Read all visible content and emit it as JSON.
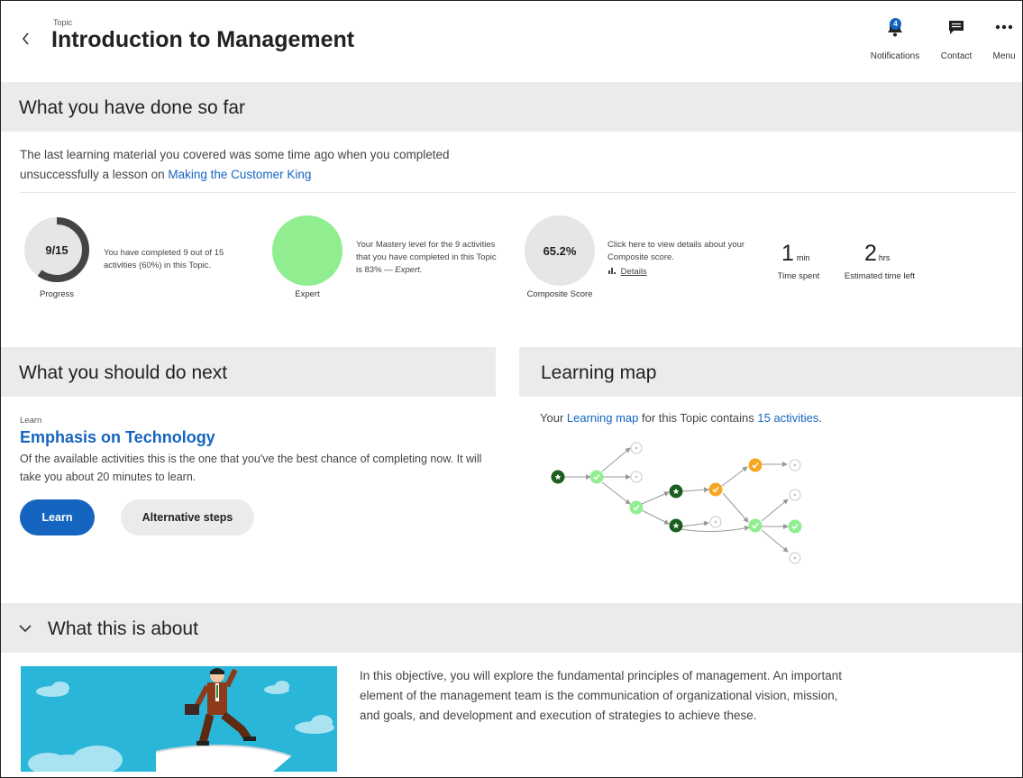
{
  "header": {
    "topic_label": "Topic",
    "title": "Introduction to Management",
    "notifications_label": "Notifications",
    "notifications_count": "4",
    "contact_label": "Contact",
    "menu_label": "Menu"
  },
  "done_section": {
    "heading": "What you have done so far",
    "intro_text": "The last learning material you covered was some time ago when you completed unsuccessfully a lesson on ",
    "intro_link": "Making the Customer King"
  },
  "stats": {
    "progress": {
      "value": "9/15",
      "completed": 9,
      "total": 15,
      "description": "You have completed 9 out of 15 activities (60%) in this Topic.",
      "caption": "Progress"
    },
    "mastery": {
      "description": "Your Mastery level for the 9 activities that you have completed in this Topic is 83% — ",
      "level": "Expert.",
      "caption": "Expert",
      "color": "#90ee90"
    },
    "composite": {
      "value": "65.2%",
      "description": "Click here to view details about your Composite score.",
      "details_link": "Details",
      "caption": "Composite Score"
    },
    "time_spent": {
      "value": "1",
      "unit": "min",
      "caption": "Time spent"
    },
    "time_left": {
      "value": "2",
      "unit": "hrs",
      "caption": "Estimated time left"
    }
  },
  "next_section": {
    "heading": "What you should do next",
    "kind": "Learn",
    "activity_title": "Emphasis on Technology",
    "description": "Of the available activities this is the one that you've the best chance of completing now.  It will take you about 20 minutes to learn.",
    "learn_button": "Learn",
    "alt_button": "Alternative steps"
  },
  "map_section": {
    "heading": "Learning map",
    "text_prefix": "Your ",
    "map_link": "Learning map",
    "text_middle": " for this Topic contains ",
    "activities_link": "15 activities",
    "text_suffix": ".",
    "colors": {
      "mastered": "#1b5e20",
      "completed": "#90ee90",
      "in_progress": "#f5a623",
      "locked": "#ffffff"
    }
  },
  "about_section": {
    "heading": "What this is about",
    "text": "In this objective, you will explore the fundamental principles of management. An important element of the management team is the communication of organizational vision, mission, and goals, and development and execution of strategies to achieve these."
  },
  "colors": {
    "accent": "#1565c0",
    "section_bg": "#ebebeb",
    "progress_ring": "#444444",
    "illustration_bg": "#29b6d8"
  }
}
